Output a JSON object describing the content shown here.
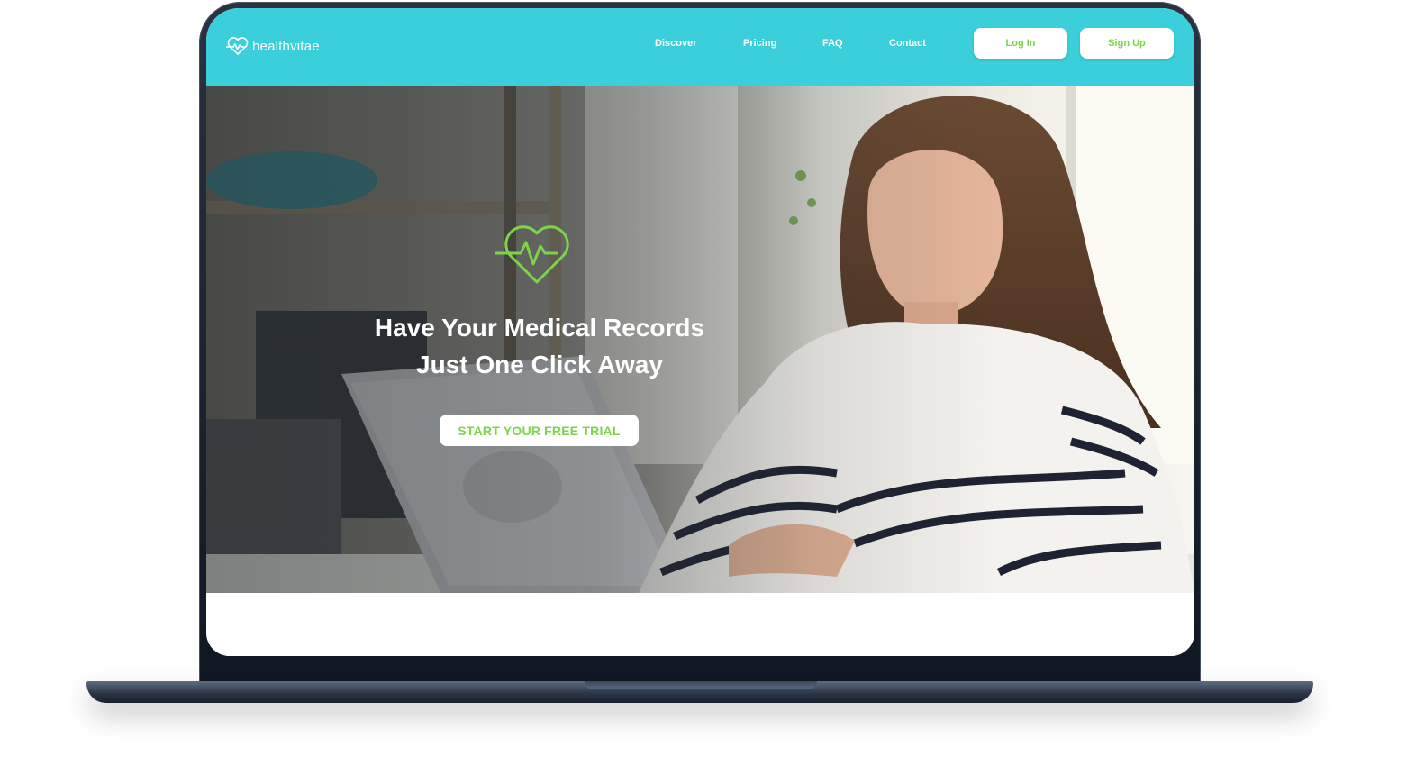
{
  "brand": {
    "name": "healthvitae",
    "logo_icon": "heart-pulse-icon",
    "color": "#3acfda"
  },
  "nav": {
    "links": [
      {
        "label": "Discover"
      },
      {
        "label": "Pricing"
      },
      {
        "label": "FAQ"
      },
      {
        "label": "Contact"
      }
    ],
    "login_label": "Log In",
    "signup_label": "Sign Up"
  },
  "hero": {
    "icon": "heart-pulse-icon",
    "title_line1": "Have Your Medical Records",
    "title_line2": "Just One Click Away",
    "cta_label": "START YOUR FREE TRIAL",
    "accent": "#7dd44a"
  }
}
